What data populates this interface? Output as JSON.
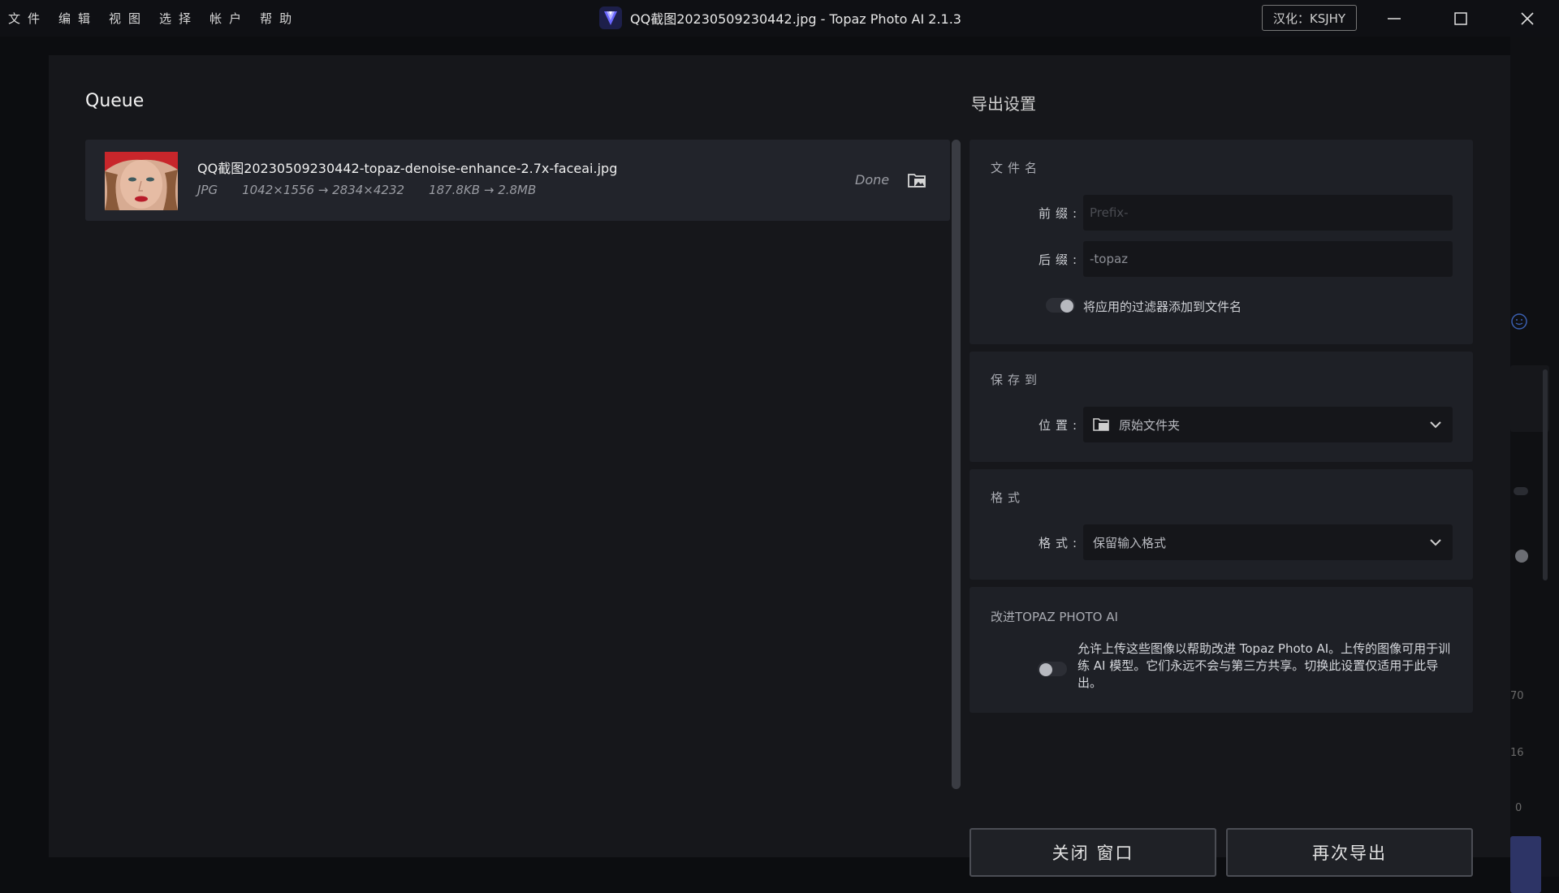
{
  "menu": [
    "文件",
    "编辑",
    "视图",
    "选择",
    "帐户",
    "帮助"
  ],
  "window": {
    "title": "QQ截图20230509230442.jpg - Topaz Photo AI 2.1.3",
    "credit": "汉化：KSJHY"
  },
  "icons": {
    "app": "topaz-gem-icon",
    "minimize": "minimize-icon",
    "maximize": "maximize-icon",
    "close": "close-icon",
    "folder": "folder-icon",
    "chevron": "chevron-down-icon"
  },
  "background_marks": [
    "70",
    "16",
    "0"
  ],
  "queue": {
    "title": "Queue",
    "items": [
      {
        "name": "QQ截图20230509230442-topaz-denoise-enhance-2.7x-faceai.jpg",
        "format": "JPG",
        "dimensions": "1042×1556 → 2834×4232",
        "size": "187.8KB → 2.8MB",
        "status": "Done"
      }
    ]
  },
  "export": {
    "title": "导出设置",
    "filename": {
      "section": "文件名",
      "prefix_label": "前缀:",
      "prefix_placeholder": "Prefix-",
      "suffix_label": "后缀:",
      "suffix_value": "-topaz",
      "append_filters_label": "将应用的过滤器添加到文件名"
    },
    "save_to": {
      "section": "保存到",
      "location_label": "位置:",
      "location_value": "原始文件夹"
    },
    "format": {
      "section": "格式",
      "format_label": "格式:",
      "format_value": "保留输入格式"
    },
    "improve": {
      "title": "改进TOPAZ PHOTO AI",
      "text": "允许上传这些图像以帮助改进 Topaz Photo AI。上传的图像可用于训练 AI 模型。它们永远不会与第三方共享。切换此设置仅适用于此导出。"
    }
  },
  "buttons": {
    "close_window": "关闭 窗口",
    "export_again": "再次导出"
  }
}
